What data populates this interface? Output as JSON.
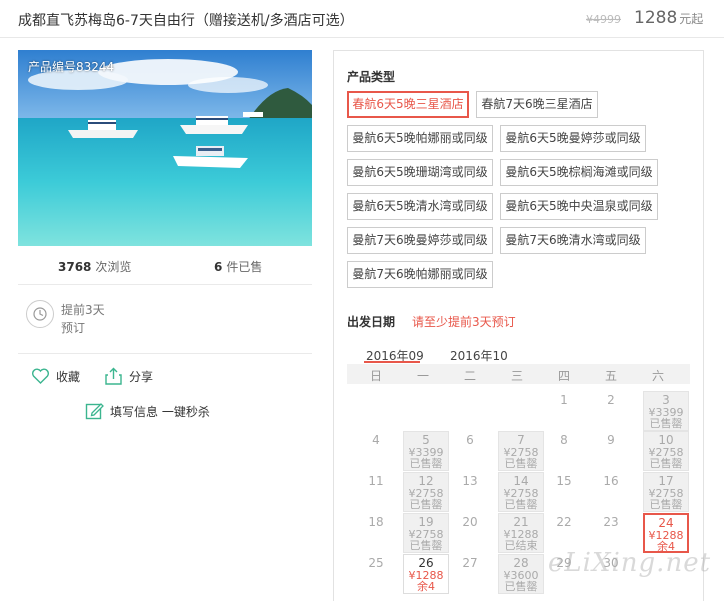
{
  "header": {
    "title": "成都直飞苏梅岛6-7天自由行（赠接送机/多酒店可选）",
    "old_price": "¥4999",
    "price": "1288",
    "price_unit": "元起"
  },
  "product": {
    "photo_label": "产品编号83244",
    "views_count": "3768",
    "views_label": "次浏览",
    "sold_count": "6",
    "sold_label": "件已售",
    "advance_line1": "提前3天",
    "advance_line2": "预订",
    "favorite_label": "收藏",
    "share_label": "分享",
    "fill_label": "填写信息 一键秒杀"
  },
  "product_type": {
    "label": "产品类型",
    "options": [
      {
        "label": "春航6天5晚三星酒店",
        "selected": true
      },
      {
        "label": "春航7天6晚三星酒店",
        "selected": false
      },
      {
        "label": "曼航6天5晚帕娜丽或同级",
        "selected": false
      },
      {
        "label": "曼航6天5晚曼婷莎或同级",
        "selected": false
      },
      {
        "label": "曼航6天5晚珊瑚湾或同级",
        "selected": false
      },
      {
        "label": "曼航6天5晚棕榈海滩或同级",
        "selected": false
      },
      {
        "label": "曼航6天5晚清水湾或同级",
        "selected": false
      },
      {
        "label": "曼航6天5晚中央温泉或同级",
        "selected": false
      },
      {
        "label": "曼航7天6晚曼婷莎或同级",
        "selected": false
      },
      {
        "label": "曼航7天6晚清水湾或同级",
        "selected": false
      },
      {
        "label": "曼航7天6晚帕娜丽或同级",
        "selected": false
      }
    ]
  },
  "departure": {
    "label": "出发日期",
    "note": "请至少提前3天预订",
    "months": [
      "2016年09",
      "2016年10"
    ],
    "weekdays": [
      "日",
      "一",
      "二",
      "三",
      "四",
      "五",
      "六"
    ],
    "days": [
      {
        "day": "1",
        "col": 4,
        "row": 0
      },
      {
        "day": "2",
        "col": 5,
        "row": 0
      },
      {
        "day": "3",
        "col": 6,
        "row": 0,
        "price": "¥3399",
        "status": "已售罄",
        "state": "soldout"
      },
      {
        "day": "4",
        "col": 0,
        "row": 1
      },
      {
        "day": "5",
        "col": 1,
        "row": 1,
        "price": "¥3399",
        "status": "已售罄",
        "state": "soldout"
      },
      {
        "day": "6",
        "col": 2,
        "row": 1
      },
      {
        "day": "7",
        "col": 3,
        "row": 1,
        "price": "¥2758",
        "status": "已售罄",
        "state": "soldout"
      },
      {
        "day": "8",
        "col": 4,
        "row": 1
      },
      {
        "day": "9",
        "col": 5,
        "row": 1
      },
      {
        "day": "10",
        "col": 6,
        "row": 1,
        "price": "¥2758",
        "status": "已售罄",
        "state": "soldout"
      },
      {
        "day": "11",
        "col": 0,
        "row": 2
      },
      {
        "day": "12",
        "col": 1,
        "row": 2,
        "price": "¥2758",
        "status": "已售罄",
        "state": "soldout"
      },
      {
        "day": "13",
        "col": 2,
        "row": 2
      },
      {
        "day": "14",
        "col": 3,
        "row": 2,
        "price": "¥2758",
        "status": "已售罄",
        "state": "soldout"
      },
      {
        "day": "15",
        "col": 4,
        "row": 2
      },
      {
        "day": "16",
        "col": 5,
        "row": 2
      },
      {
        "day": "17",
        "col": 6,
        "row": 2,
        "price": "¥2758",
        "status": "已售罄",
        "state": "soldout"
      },
      {
        "day": "18",
        "col": 0,
        "row": 3
      },
      {
        "day": "19",
        "col": 1,
        "row": 3,
        "price": "¥2758",
        "status": "已售罄",
        "state": "soldout"
      },
      {
        "day": "20",
        "col": 2,
        "row": 3
      },
      {
        "day": "21",
        "col": 3,
        "row": 3,
        "price": "¥1288",
        "status": "已结束",
        "state": "soldout"
      },
      {
        "day": "22",
        "col": 4,
        "row": 3
      },
      {
        "day": "23",
        "col": 5,
        "row": 3
      },
      {
        "day": "24",
        "col": 6,
        "row": 3,
        "price": "¥1288",
        "status": "余4",
        "state": "selected"
      },
      {
        "day": "25",
        "col": 0,
        "row": 4
      },
      {
        "day": "26",
        "col": 1,
        "row": 4,
        "price": "¥1288",
        "status": "余4",
        "state": "available"
      },
      {
        "day": "27",
        "col": 2,
        "row": 4
      },
      {
        "day": "28",
        "col": 3,
        "row": 4,
        "price": "¥3600",
        "status": "已售罄",
        "state": "soldout"
      },
      {
        "day": "29",
        "col": 4,
        "row": 4
      },
      {
        "day": "30",
        "col": 5,
        "row": 4
      }
    ]
  },
  "watermark": "eLiXing.net",
  "colors": {
    "accent": "#e8574a",
    "icon_green": "#3bb58f"
  }
}
